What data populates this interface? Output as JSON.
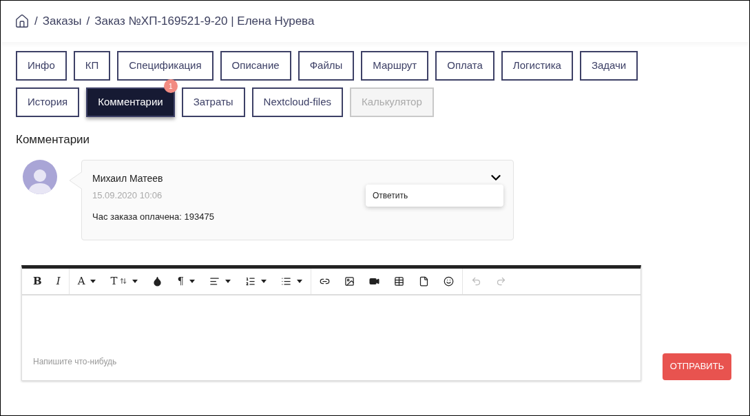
{
  "breadcrumb": [
    {
      "separator": "/",
      "label": "Заказы"
    },
    {
      "separator": "/",
      "label": "Заказ №ХП-169521-9-20 | Елена Нурева"
    }
  ],
  "tabs": [
    {
      "label": "Инфо",
      "selected": false,
      "disabled": false
    },
    {
      "label": "КП",
      "selected": false,
      "disabled": false
    },
    {
      "label": "Спецификация",
      "selected": false,
      "disabled": false
    },
    {
      "label": "Описание",
      "selected": false,
      "disabled": false
    },
    {
      "label": "Файлы",
      "selected": false,
      "disabled": false
    },
    {
      "label": "Маршрут",
      "selected": false,
      "disabled": false
    },
    {
      "label": "Оплата",
      "selected": false,
      "disabled": false
    },
    {
      "label": "Логистика",
      "selected": false,
      "disabled": false
    },
    {
      "label": "Задачи",
      "selected": false,
      "disabled": false
    },
    {
      "label": "История",
      "selected": false,
      "disabled": false
    },
    {
      "label": "Комментарии",
      "selected": true,
      "disabled": false,
      "badge": "1"
    },
    {
      "label": "Затраты",
      "selected": false,
      "disabled": false
    },
    {
      "label": "Nextcloud-files",
      "selected": false,
      "disabled": false
    },
    {
      "label": "Калькулятор",
      "selected": false,
      "disabled": true
    }
  ],
  "section_title": "Комментарии",
  "comments": [
    {
      "author": "Михаил Матеев",
      "date": "15.09.2020 10:06",
      "text": "Час заказа оплачена: 193475",
      "menu_open": true,
      "menu": [
        "Ответить"
      ]
    }
  ],
  "editor": {
    "toolbar": [
      [
        {
          "kind": "bold",
          "label": "B",
          "dropdown": false,
          "disabled": false
        },
        {
          "kind": "italic",
          "label": "I",
          "dropdown": false,
          "disabled": false
        }
      ],
      [
        {
          "kind": "font",
          "label": "A",
          "dropdown": true,
          "disabled": false
        },
        {
          "kind": "size",
          "label": "T",
          "dropdown": true,
          "disabled": false
        },
        {
          "kind": "color",
          "dropdown": false,
          "disabled": false
        },
        {
          "kind": "paragraph",
          "label": "¶",
          "dropdown": true,
          "disabled": false
        },
        {
          "kind": "align",
          "dropdown": true,
          "disabled": false
        },
        {
          "kind": "ol",
          "dropdown": true,
          "disabled": false
        },
        {
          "kind": "ul",
          "dropdown": true,
          "disabled": false
        }
      ],
      [
        {
          "kind": "link",
          "dropdown": false,
          "disabled": false
        },
        {
          "kind": "image",
          "dropdown": false,
          "disabled": false
        },
        {
          "kind": "video",
          "dropdown": false,
          "disabled": false
        },
        {
          "kind": "table",
          "dropdown": false,
          "disabled": false
        },
        {
          "kind": "file",
          "dropdown": false,
          "disabled": false
        },
        {
          "kind": "emoji",
          "dropdown": false,
          "disabled": false
        }
      ],
      [
        {
          "kind": "undo",
          "dropdown": false,
          "disabled": true
        },
        {
          "kind": "redo",
          "dropdown": false,
          "disabled": true
        }
      ]
    ],
    "placeholder": "Напишите что-нибудь"
  },
  "submit": "ОТПРАВИТЬ"
}
